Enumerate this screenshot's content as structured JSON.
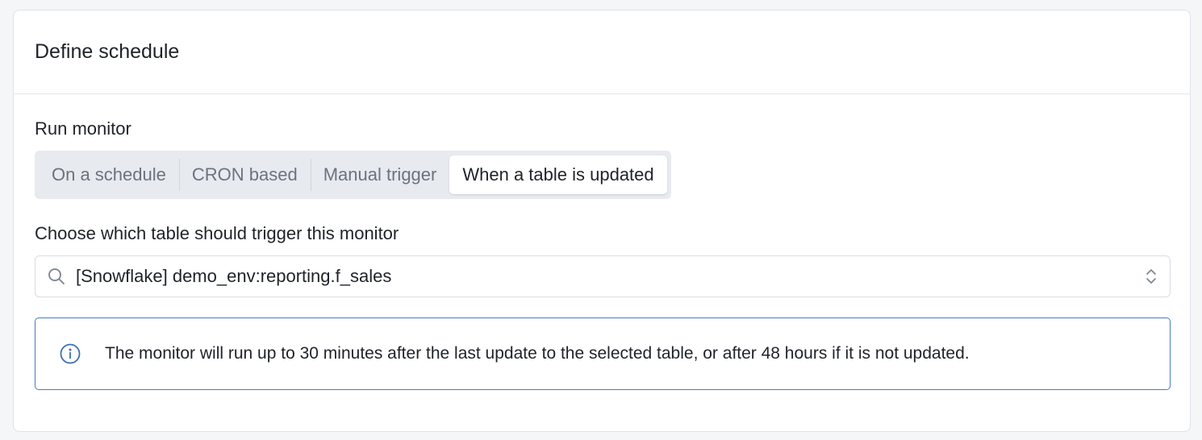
{
  "card": {
    "title": "Define schedule"
  },
  "run_monitor": {
    "label": "Run monitor",
    "options": [
      {
        "label": "On a schedule",
        "selected": false
      },
      {
        "label": "CRON based",
        "selected": false
      },
      {
        "label": "Manual trigger",
        "selected": false
      },
      {
        "label": "When a table is updated",
        "selected": true
      }
    ]
  },
  "table_trigger": {
    "label": "Choose which table should trigger this monitor",
    "value": "[Snowflake] demo_env:reporting.f_sales",
    "icons": {
      "left": "search-icon",
      "right": "chevron-up-down-icon"
    }
  },
  "info_banner": {
    "icon": "info-icon",
    "text": "The monitor will run up to 30 minutes after the last update to the selected table, or after 48 hours if it is not updated.",
    "border_color": "#4a7bbf"
  }
}
